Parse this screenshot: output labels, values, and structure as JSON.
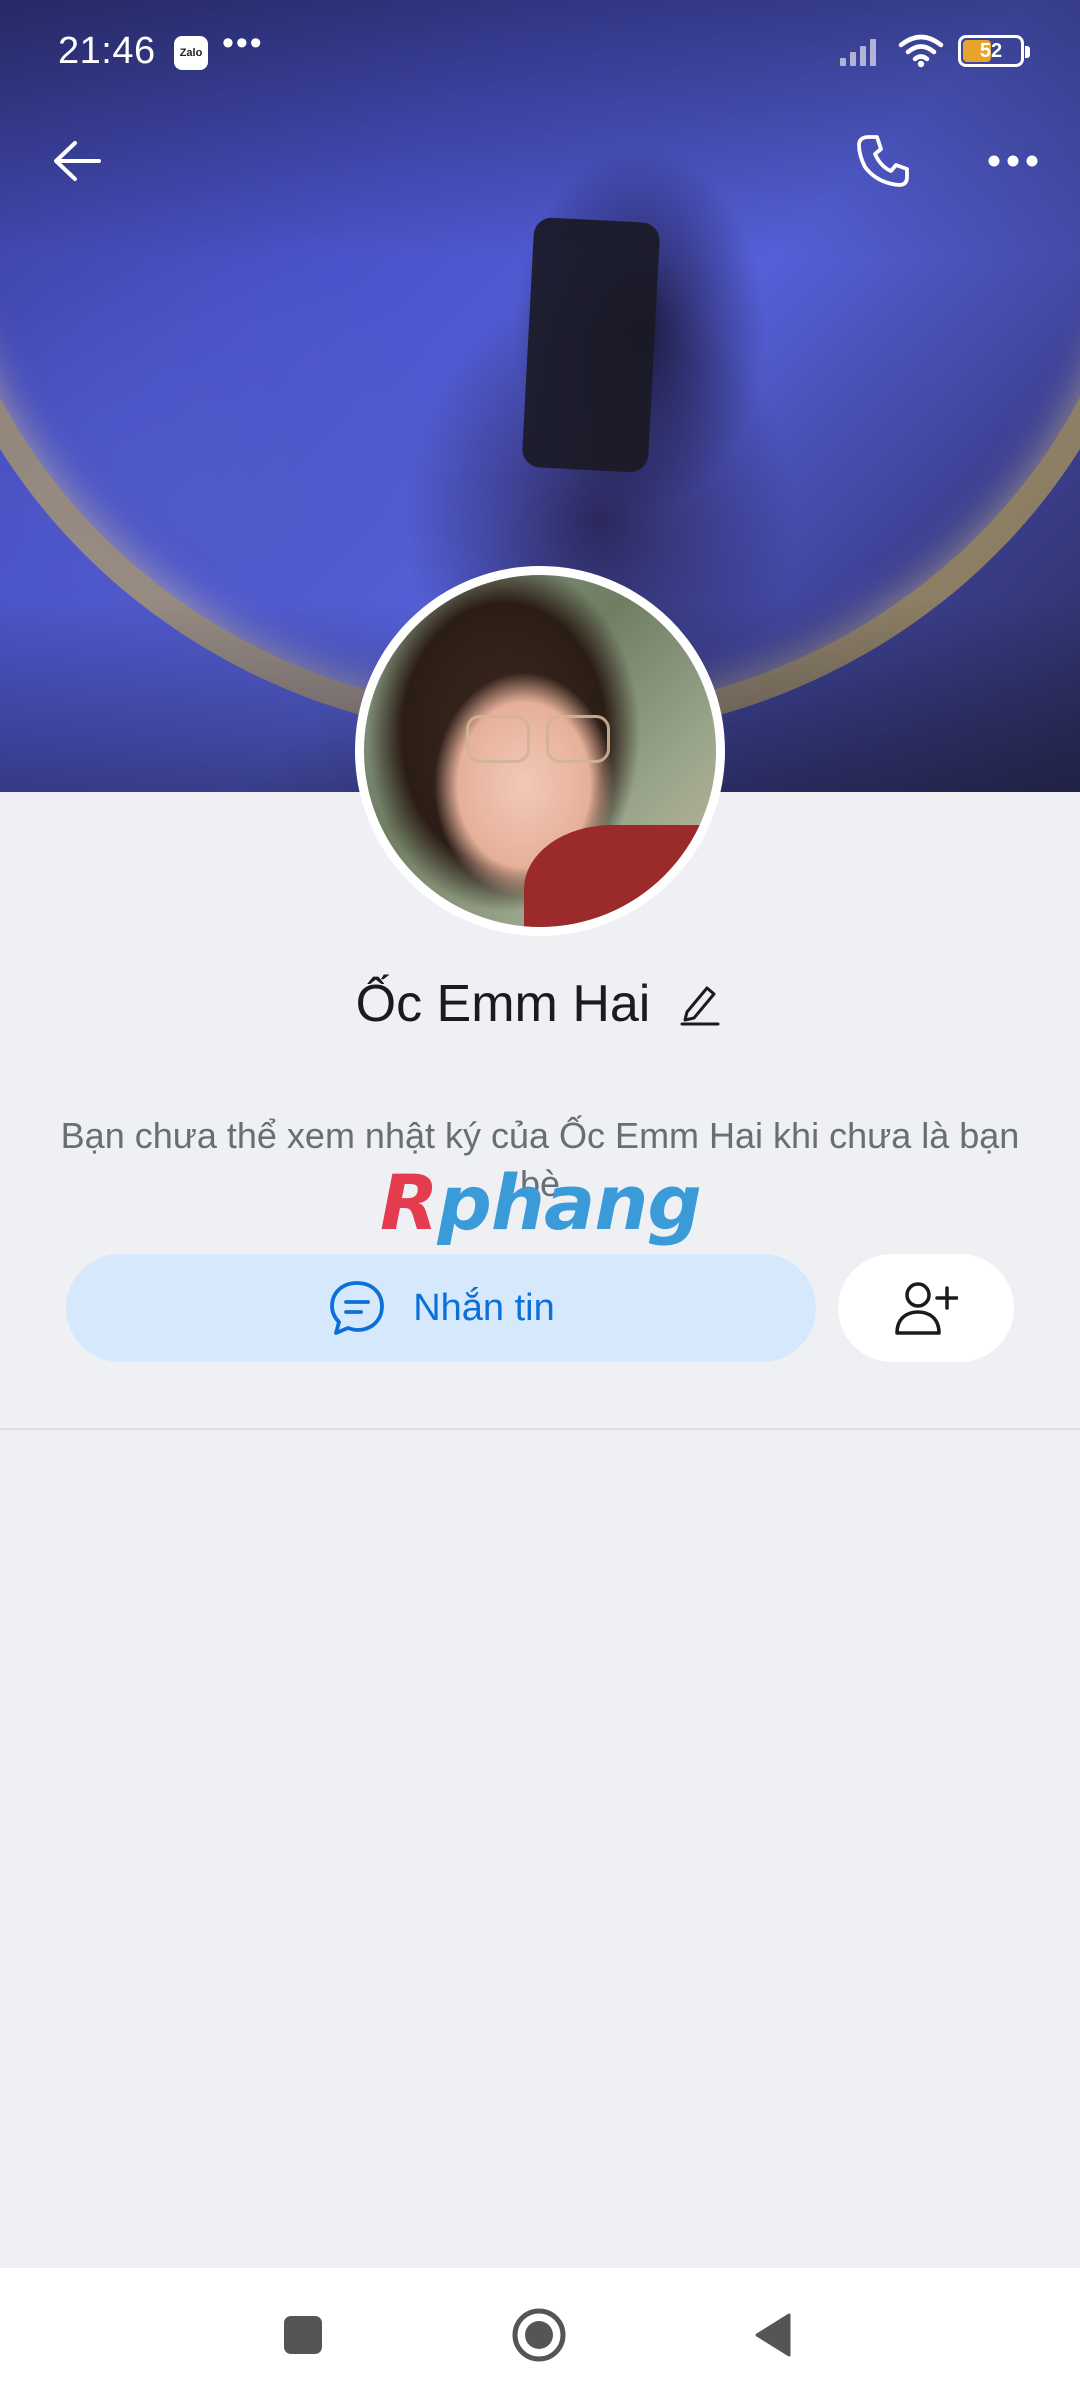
{
  "status_bar": {
    "time": "21:46",
    "app_badge": "Zalo",
    "more_dots": "•••",
    "battery_level": "52",
    "battery_fill_percent": 52,
    "battery_color": "#e7a32b"
  },
  "header": {
    "back_icon": "back-arrow-icon",
    "call_icon": "phone-icon",
    "more_icon": "more-dots-icon"
  },
  "profile": {
    "name": "Ốc Emm Hai",
    "edit_icon": "pencil-icon",
    "notice": "Bạn chưa thể xem nhật ký của Ốc Emm Hai khi chưa là bạn bè"
  },
  "watermark": {
    "part_a": "R",
    "part_b": "phang",
    "color_a": "#e43b4f",
    "color_b": "#3a9bd8"
  },
  "actions": {
    "message_label": "Nhắn tin",
    "message_icon": "chat-bubble-icon",
    "add_friend_icon": "add-user-icon",
    "accent_color": "#0d6fd8",
    "message_bg": "#d6e8fb"
  },
  "nav_bar": {
    "recents_icon": "square-icon",
    "home_icon": "circle-icon",
    "back_icon": "triangle-back-icon"
  }
}
